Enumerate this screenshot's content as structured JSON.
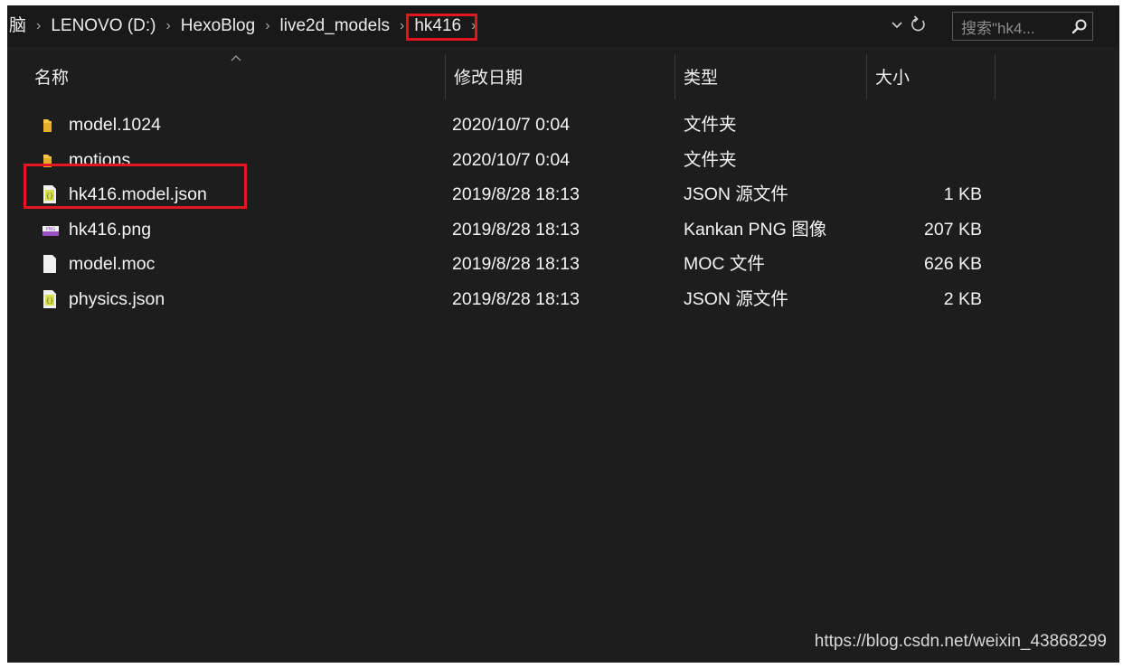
{
  "breadcrumb": [
    {
      "label": "脑"
    },
    {
      "label": "LENOVO (D:)"
    },
    {
      "label": "HexoBlog"
    },
    {
      "label": "live2d_models"
    },
    {
      "label": "hk416"
    }
  ],
  "breadcrumb_separator": "›",
  "nav": {
    "dropdown_icon": "chevron-down-icon",
    "refresh_icon": "refresh-icon"
  },
  "search": {
    "placeholder": "搜索\"hk4...",
    "icon": "search-icon"
  },
  "columns": [
    {
      "key": "name",
      "label": "名称"
    },
    {
      "key": "modified",
      "label": "修改日期"
    },
    {
      "key": "type",
      "label": "类型"
    },
    {
      "key": "size",
      "label": "大小"
    }
  ],
  "files": [
    {
      "icon": "folder-icon",
      "name": "model.1024",
      "modified": "2020/10/7 0:04",
      "type": "文件夹",
      "size": ""
    },
    {
      "icon": "folder-icon",
      "name": "motions",
      "modified": "2020/10/7 0:04",
      "type": "文件夹",
      "size": ""
    },
    {
      "icon": "json-file-icon",
      "name": "hk416.model.json",
      "modified": "2019/8/28 18:13",
      "type": "JSON 源文件",
      "size": "1 KB"
    },
    {
      "icon": "png-file-icon",
      "name": "hk416.png",
      "modified": "2019/8/28 18:13",
      "type": "Kankan PNG 图像",
      "size": "207 KB"
    },
    {
      "icon": "file-icon",
      "name": "model.moc",
      "modified": "2019/8/28 18:13",
      "type": "MOC 文件",
      "size": "626 KB"
    },
    {
      "icon": "json-file-icon",
      "name": "physics.json",
      "modified": "2019/8/28 18:13",
      "type": "JSON 源文件",
      "size": "2 KB"
    }
  ],
  "highlights": {
    "color": "#e5161e"
  },
  "colors": {
    "background": "#1d1d1d",
    "text": "#f4f4f4",
    "folder": "#f3c64b",
    "json": "#d6e04a",
    "png": "#9b4fc5"
  },
  "watermark": "https://blog.csdn.net/weixin_43868299"
}
